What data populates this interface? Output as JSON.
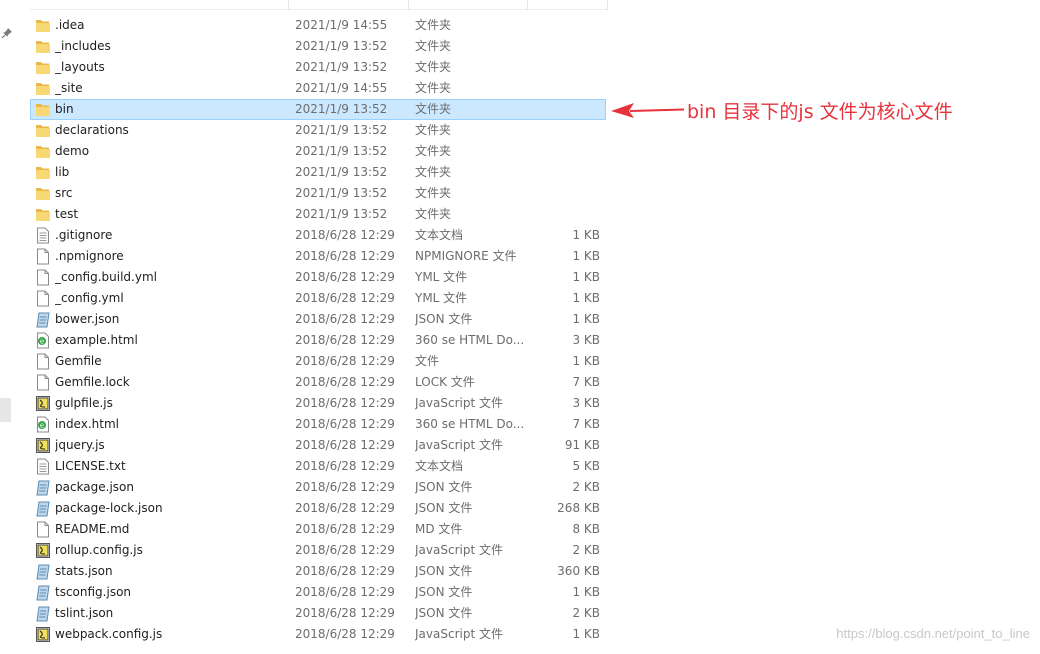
{
  "files": [
    {
      "name": ".idea",
      "date": "2021/1/9 14:55",
      "type": "文件夹",
      "size": "",
      "icon": "folder-icon"
    },
    {
      "name": "_includes",
      "date": "2021/1/9 13:52",
      "type": "文件夹",
      "size": "",
      "icon": "folder-icon"
    },
    {
      "name": "_layouts",
      "date": "2021/1/9 13:52",
      "type": "文件夹",
      "size": "",
      "icon": "folder-icon"
    },
    {
      "name": "_site",
      "date": "2021/1/9 14:55",
      "type": "文件夹",
      "size": "",
      "icon": "folder-icon"
    },
    {
      "name": "bin",
      "date": "2021/1/9 13:52",
      "type": "文件夹",
      "size": "",
      "icon": "folder-icon",
      "selected": true
    },
    {
      "name": "declarations",
      "date": "2021/1/9 13:52",
      "type": "文件夹",
      "size": "",
      "icon": "folder-icon"
    },
    {
      "name": "demo",
      "date": "2021/1/9 13:52",
      "type": "文件夹",
      "size": "",
      "icon": "folder-icon"
    },
    {
      "name": "lib",
      "date": "2021/1/9 13:52",
      "type": "文件夹",
      "size": "",
      "icon": "folder-icon"
    },
    {
      "name": "src",
      "date": "2021/1/9 13:52",
      "type": "文件夹",
      "size": "",
      "icon": "folder-icon"
    },
    {
      "name": "test",
      "date": "2021/1/9 13:52",
      "type": "文件夹",
      "size": "",
      "icon": "folder-icon"
    },
    {
      "name": ".gitignore",
      "date": "2018/6/28 12:29",
      "type": "文本文档",
      "size": "1 KB",
      "icon": "text-file-icon"
    },
    {
      "name": ".npmignore",
      "date": "2018/6/28 12:29",
      "type": "NPMIGNORE 文件",
      "size": "1 KB",
      "icon": "blank-file-icon"
    },
    {
      "name": "_config.build.yml",
      "date": "2018/6/28 12:29",
      "type": "YML 文件",
      "size": "1 KB",
      "icon": "blank-file-icon"
    },
    {
      "name": "_config.yml",
      "date": "2018/6/28 12:29",
      "type": "YML 文件",
      "size": "1 KB",
      "icon": "blank-file-icon"
    },
    {
      "name": "bower.json",
      "date": "2018/6/28 12:29",
      "type": "JSON 文件",
      "size": "1 KB",
      "icon": "json-file-icon"
    },
    {
      "name": "example.html",
      "date": "2018/6/28 12:29",
      "type": "360 se HTML Do...",
      "size": "3 KB",
      "icon": "html-file-icon"
    },
    {
      "name": "Gemfile",
      "date": "2018/6/28 12:29",
      "type": "文件",
      "size": "1 KB",
      "icon": "blank-file-icon"
    },
    {
      "name": "Gemfile.lock",
      "date": "2018/6/28 12:29",
      "type": "LOCK 文件",
      "size": "7 KB",
      "icon": "blank-file-icon"
    },
    {
      "name": "gulpfile.js",
      "date": "2018/6/28 12:29",
      "type": "JavaScript 文件",
      "size": "3 KB",
      "icon": "js-file-icon"
    },
    {
      "name": "index.html",
      "date": "2018/6/28 12:29",
      "type": "360 se HTML Do...",
      "size": "7 KB",
      "icon": "html-file-icon"
    },
    {
      "name": "jquery.js",
      "date": "2018/6/28 12:29",
      "type": "JavaScript 文件",
      "size": "91 KB",
      "icon": "js-file-icon"
    },
    {
      "name": "LICENSE.txt",
      "date": "2018/6/28 12:29",
      "type": "文本文档",
      "size": "5 KB",
      "icon": "text-file-icon"
    },
    {
      "name": "package.json",
      "date": "2018/6/28 12:29",
      "type": "JSON 文件",
      "size": "2 KB",
      "icon": "json-file-icon"
    },
    {
      "name": "package-lock.json",
      "date": "2018/6/28 12:29",
      "type": "JSON 文件",
      "size": "268 KB",
      "icon": "json-file-icon"
    },
    {
      "name": "README.md",
      "date": "2018/6/28 12:29",
      "type": "MD 文件",
      "size": "8 KB",
      "icon": "blank-file-icon"
    },
    {
      "name": "rollup.config.js",
      "date": "2018/6/28 12:29",
      "type": "JavaScript 文件",
      "size": "2 KB",
      "icon": "js-file-icon"
    },
    {
      "name": "stats.json",
      "date": "2018/6/28 12:29",
      "type": "JSON 文件",
      "size": "360 KB",
      "icon": "json-file-icon"
    },
    {
      "name": "tsconfig.json",
      "date": "2018/6/28 12:29",
      "type": "JSON 文件",
      "size": "1 KB",
      "icon": "json-file-icon"
    },
    {
      "name": "tslint.json",
      "date": "2018/6/28 12:29",
      "type": "JSON 文件",
      "size": "2 KB",
      "icon": "json-file-icon"
    },
    {
      "name": "webpack.config.js",
      "date": "2018/6/28 12:29",
      "type": "JavaScript 文件",
      "size": "1 KB",
      "icon": "js-file-icon"
    }
  ],
  "annotation": {
    "text": "bin 目录下的js 文件为核心文件",
    "color": "#e8323c"
  },
  "watermark": "https://blog.csdn.net/point_to_line",
  "colors": {
    "selection_bg": "#cce8ff",
    "selection_border": "#99d1ff",
    "folder": "#f8d775"
  }
}
